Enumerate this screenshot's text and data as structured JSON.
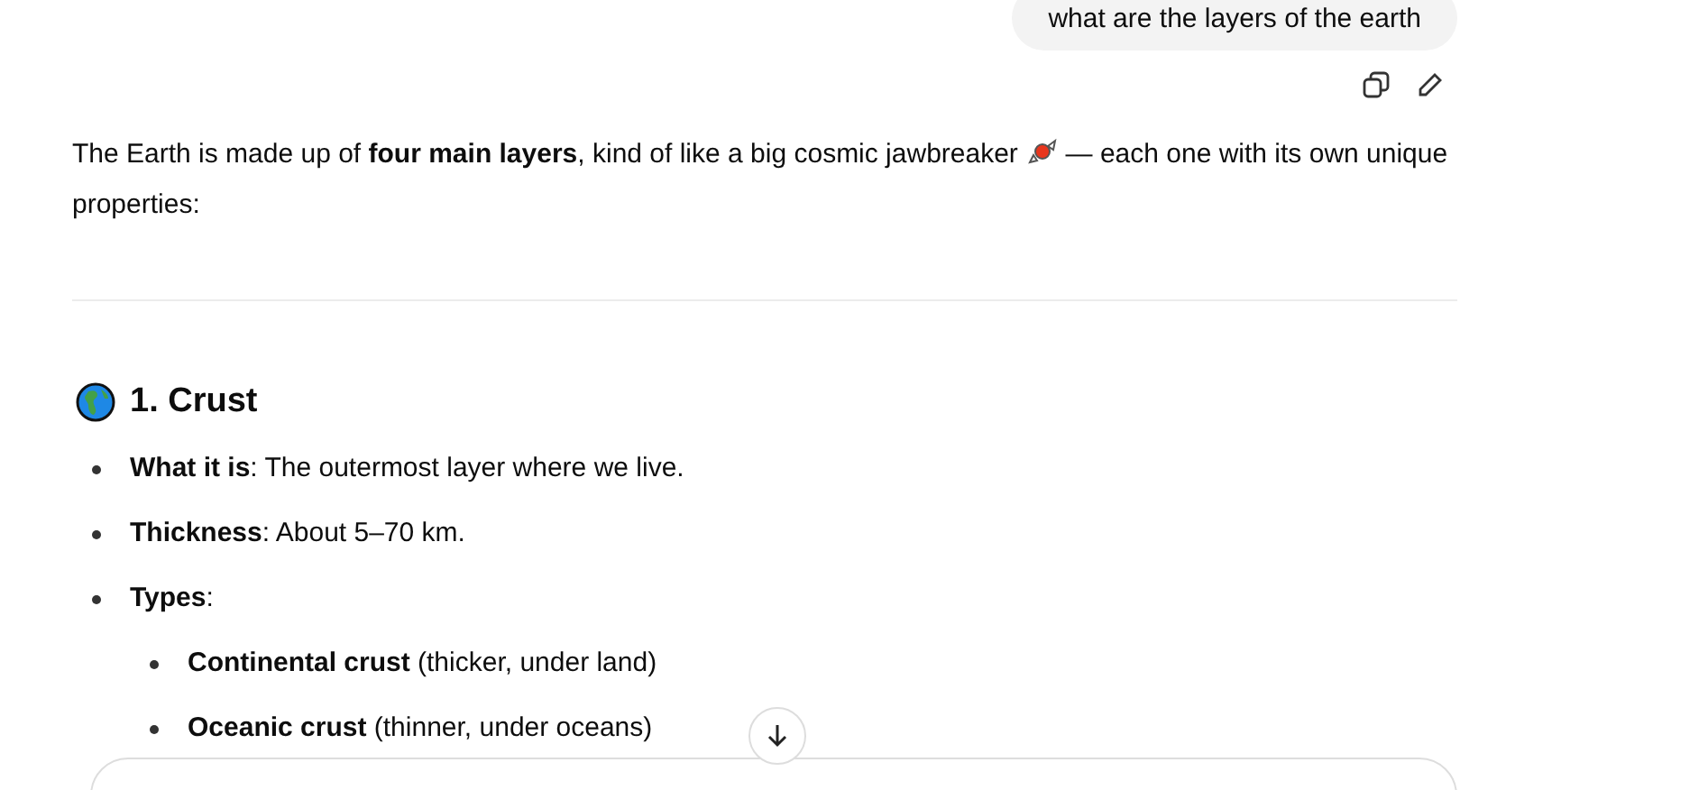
{
  "user_message": {
    "text": "what are the layers of the earth"
  },
  "intro": {
    "before": "The Earth is made up of **four main layers**, kind of like a big cosmic jawbreaker",
    "after": "— each one with its own unique properties:"
  },
  "section": {
    "title": "1. Crust",
    "items": [
      {
        "text": "**What it is**: The outermost layer where we live."
      },
      {
        "text": "**Thickness**: About 5–70 km."
      },
      {
        "text": "**Types**:",
        "children": [
          {
            "text": "**Continental crust** (thicker, under land)"
          },
          {
            "text": "**Oceanic crust** (thinner, under oceans)"
          }
        ]
      }
    ]
  }
}
